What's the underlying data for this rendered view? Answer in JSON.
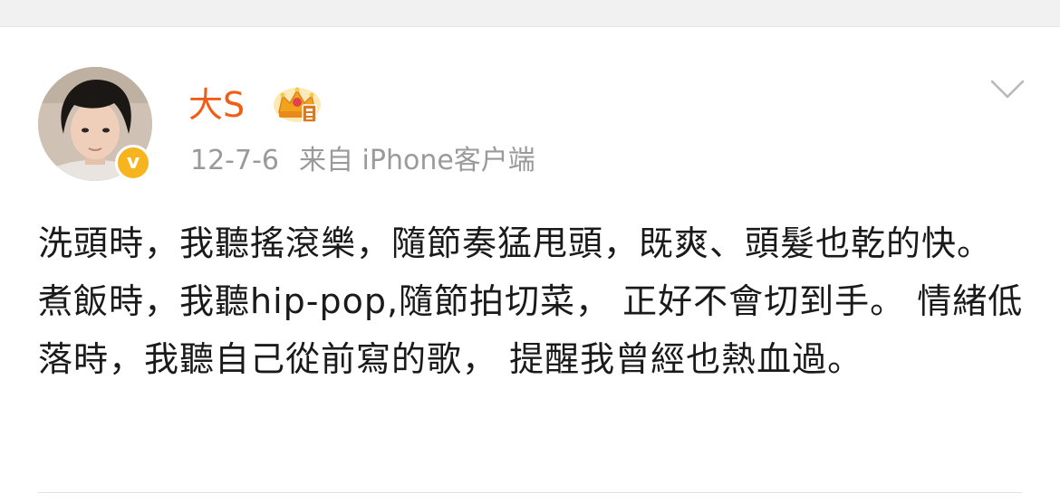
{
  "post": {
    "username": "大S",
    "date": "12-7-6",
    "source": "来自 iPhone客户端",
    "text": "洗頭時，我聽搖滾樂，隨節奏猛甩頭，既爽、頭髮也乾的快。 煮飯時，我聽hip-pop,隨節拍切菜， 正好不會切到手。 情緒低落時，我聽自己從前寫的歌， 提醒我曾經也熱血過。"
  },
  "icons": {
    "verified": "verified-v-icon",
    "badge": "crown-membership-icon",
    "menu": "chevron-down-icon"
  },
  "colors": {
    "username": "#f25d16",
    "meta": "#9a9a9a",
    "text": "#1a1a1a",
    "verified": "#f6b51e"
  }
}
